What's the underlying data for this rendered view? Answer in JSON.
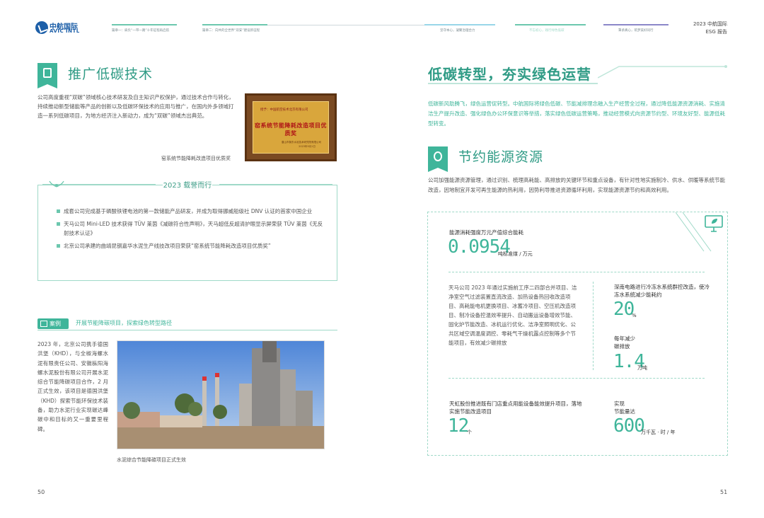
{
  "header": {
    "logo_cn": "中航国际",
    "logo_en": "AVIC INTL",
    "nav": [
      "篇章一：肩负“一带一路”十年征程再启航",
      "篇章二：向共的全世界“双安”建设新征程",
      "坚守本心，凝聚治理合力",
      "不忘初心，践行绿色低碳",
      "秉承真心，筑梦美好同行"
    ],
    "report_org": "2023 中航国际",
    "report_type": "ESG 报告",
    "colors": [
      "#3fb59a",
      "#6cc7ae",
      "#98d6e8",
      "#2f9b85",
      "#8b87c9"
    ]
  },
  "left": {
    "section_title": "推广低碳技术",
    "intro": "公司高度重视“双碳”领域核心技术研发及自主知识产权保护，通过技术合作与转化，持续推动新型储能等产品的创新以及低碳环保技术的应用与推广，在国内外多领域打造一系列低碳项目，为地方经济注入新动力，成为“双碳”领域杰出典范。",
    "certificate": {
      "issuer": "授予：中国航空技术北京有限公司",
      "title": "窑系统节能降耗改造项目优质奖",
      "signature": "唐山市冀东水泥技术研究院有限公司",
      "date": "2023年9月1日",
      "caption": "窑系统节能降耗改造项目优质奖"
    },
    "honors": {
      "title": "2023 载誉而行",
      "items": [
        "成套公司完成基于磷酸铁锂电池的第一款储能产品研发，并成为取得挪威船级社 DNV 认证的首家中国企业",
        "天马公司 Mini-LED 技术获得 TÜV 莱茵《减碳符合性声明》，天马超低反超清护眼显示屏荣获 TÜV 莱茵《无反射技术认证》",
        "北京公司承建的曲靖昆钢嘉华水泥生产线技改项目荣获“窑系统节能降耗改造项目优质奖”"
      ]
    },
    "case": {
      "tag": "案例",
      "title": "开展节能降碳项目，探索绿色转型路径",
      "text": "2023 年，北京公司携手德国洪堡（KHD），与全椒海螺水泥有限责任公司、安徽枞阳海螺水泥股份有限公司开展水泥综合节能降碳项目合作，2 月正式生效，该项目是德国洪堡（KHD）探索节能环保技术装备，助力水泥行业实现碳达峰碳中和目标的又一重要里程碑。",
      "photo_caption": "水泥综合节能降碳项目正式生效"
    },
    "page_number": "50"
  },
  "right": {
    "main_title": "低碳转型，夯实绿色运营",
    "main_text": "低碳新风助腾飞，绿色运营促转型。中航国际将绿色低碳、节能减排理念融入生产经营全过程，通过降低能源资源消耗、实施清洁生产提升改造、强化绿色办公环保意识等举措，落实绿色低碳运营策略，推动经营模式向资源节约型、环境友好型、能源低耗型转变。",
    "section_title": "节约能源资源",
    "section_text": "公司加强能源资源管理，通过识别、梳理高耗能、高排放的关键环节和重点设备，有针对性地实施制冷、供水、供暖等系统节能改造，因地制宜开发可再生能源的热利用，因势利导推进资源循环利用，实现能源资源节约和高效利用。",
    "stats": {
      "intensity_label": "能源消耗强度万元产值综合能耗",
      "intensity_value": "0.0954",
      "intensity_unit": "吨标准煤 / 万元",
      "tianma_text": "天马公司 2023 年通过实施前工序二四部合并项目、洁净室空气过滤装置直流改造、加热设备热回收改造项目、高耗能电机更换项目、冰蓄冷项目、空压机改造项目、制冷设备控温效率提升、自动搬运设备增效节能、固化炉节能改造、冰机运行优化、洁净室照明优化、公共区域空调温度调控、零耗气干燥机露点控制等多个节能项目，有效减少碳排放",
      "shennan_label": "深南电路进行冷冻水系统群控改造，使冷冻水系统减少能耗约",
      "shennan_value": "20",
      "shennan_unit": "%",
      "reduce_label_1": "每年减少",
      "reduce_label_2": "碳排放",
      "reduce_value": "1.4",
      "reduce_unit": "万吨",
      "tianhong_label": "天虹股份推进既有门店重点用能设备能效提升项目，落地实施节能改造项目",
      "tianhong_value": "12",
      "tianhong_unit": "个",
      "saving_label_1": "实现",
      "saving_label_2": "节能量达",
      "saving_value": "600",
      "saving_unit": "万千瓦 · 时 / 年"
    },
    "page_number": "51"
  }
}
